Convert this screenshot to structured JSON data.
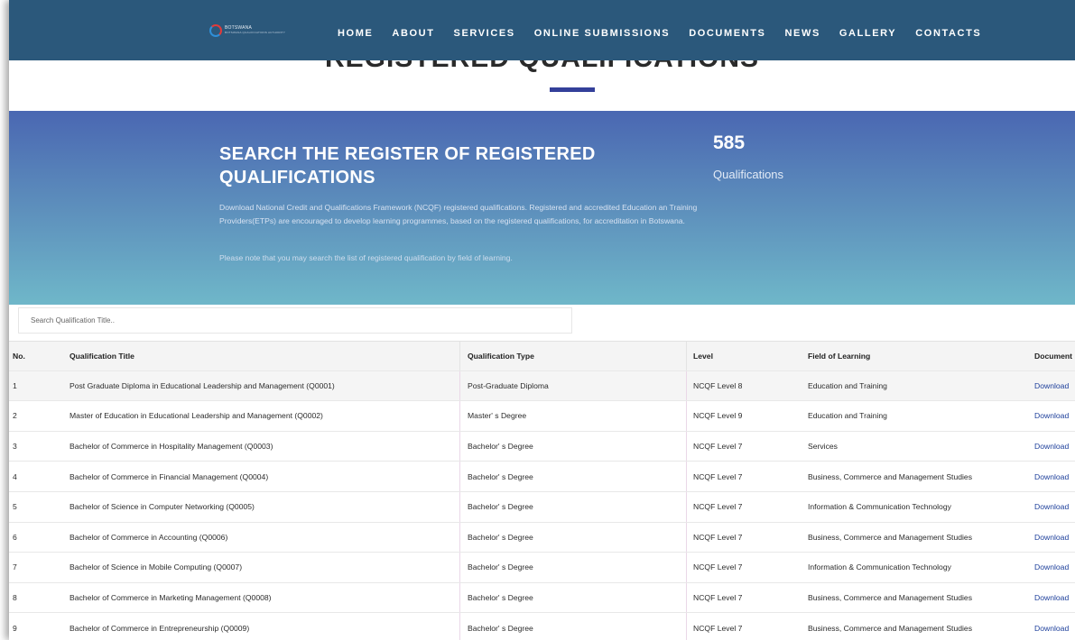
{
  "nav": {
    "logo_line1": "BOTSWANA",
    "logo_line2": "BOTSWANA QUALIFICATIONS AUTHORITY",
    "items": [
      "HOME",
      "ABOUT",
      "SERVICES",
      "ONLINE SUBMISSIONS",
      "DOCUMENTS",
      "NEWS",
      "GALLERY",
      "CONTACTS"
    ]
  },
  "page_title": "REGISTERED QUALIFICATIONS",
  "hero": {
    "heading": "SEARCH THE REGISTER OF REGISTERED QUALIFICATIONS",
    "description": "Download National Credit and Qualifications Framework (NCQF) registered qualifications. Registered and accredited Education an Training Providers(ETPs) are encouraged to develop learning programmes, based on the registered qualifications, for accreditation in Botswana.",
    "note": "Please note that you may search the list of registered qualification by field of learning.",
    "stat_value": "585",
    "stat_label": "Qualifications"
  },
  "search": {
    "placeholder": "Search Qualification Title.."
  },
  "table": {
    "headers": {
      "no": "No.",
      "title": "Qualification Title",
      "type": "Qualification Type",
      "level": "Level",
      "field": "Field of Learning",
      "doc": "Document"
    },
    "rows": [
      {
        "no": "1",
        "title": "Post Graduate Diploma in Educational Leadership and Management (Q0001)",
        "type": "Post-Graduate Diploma",
        "level": "NCQF Level 8",
        "field": "Education and Training",
        "doc": "Download"
      },
      {
        "no": "2",
        "title": "Master of Education in Educational Leadership and Management (Q0002)",
        "type": "Master' s Degree",
        "level": "NCQF Level 9",
        "field": "Education and Training",
        "doc": "Download"
      },
      {
        "no": "3",
        "title": "Bachelor of Commerce in Hospitality Management (Q0003)",
        "type": "Bachelor' s Degree",
        "level": "NCQF Level 7",
        "field": "Services",
        "doc": "Download"
      },
      {
        "no": "4",
        "title": "Bachelor of Commerce in Financial Management (Q0004)",
        "type": "Bachelor' s Degree",
        "level": "NCQF Level 7",
        "field": "Business, Commerce and Management Studies",
        "doc": "Download"
      },
      {
        "no": "5",
        "title": "Bachelor of Science in Computer Networking (Q0005)",
        "type": "Bachelor' s Degree",
        "level": "NCQF Level 7",
        "field": "Information & Communication Technology",
        "doc": "Download"
      },
      {
        "no": "6",
        "title": "Bachelor of Commerce in Accounting (Q0006)",
        "type": "Bachelor' s Degree",
        "level": "NCQF Level 7",
        "field": "Business, Commerce and Management Studies",
        "doc": "Download"
      },
      {
        "no": "7",
        "title": "Bachelor of Science in Mobile Computing (Q0007)",
        "type": "Bachelor' s Degree",
        "level": "NCQF Level 7",
        "field": "Information & Communication Technology",
        "doc": "Download"
      },
      {
        "no": "8",
        "title": "Bachelor of Commerce in Marketing Management (Q0008)",
        "type": "Bachelor' s Degree",
        "level": "NCQF Level 7",
        "field": "Business, Commerce and Management Studies",
        "doc": "Download"
      },
      {
        "no": "9",
        "title": "Bachelor of Commerce in Entrepreneurship (Q0009)",
        "type": "Bachelor' s Degree",
        "level": "NCQF Level 7",
        "field": "Business, Commerce and Management Studies",
        "doc": "Download"
      }
    ]
  },
  "colors": {
    "nav_bg": "#2b587b",
    "hero_top": "#4a67b2",
    "hero_bottom": "#6fb7c9",
    "accent": "#34409a",
    "link": "#1d3f9b"
  }
}
